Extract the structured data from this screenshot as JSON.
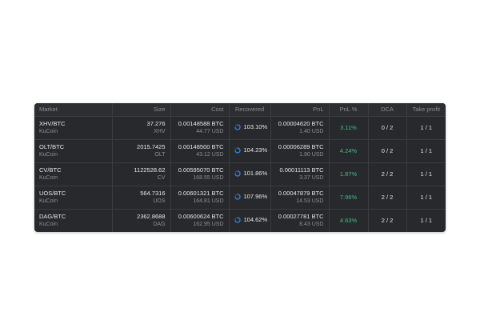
{
  "columns": {
    "market": "Market",
    "size": "Size",
    "cost": "Cost",
    "recovered": "Recovered",
    "pnl": "PnL",
    "pnl_pct": "PnL %",
    "dca": "DCA",
    "take_profit": "Take profit"
  },
  "colors": {
    "panel_bg": "#27292c",
    "accent_blue": "#2f80ed",
    "positive_green": "#3ec17b"
  },
  "rows": [
    {
      "pair": "XHV/BTC",
      "exchange": "KuCoin",
      "size": "37.276",
      "size_unit": "XHV",
      "cost_btc": "0.00148588 BTC",
      "cost_usd": "44.77 USD",
      "recovered": "103.10%",
      "pnl_btc": "0.00004620 BTC",
      "pnl_usd": "1.40 USD",
      "pnl_pct": "3.11%",
      "dca": "0 / 2",
      "take_profit": "1 / 1"
    },
    {
      "pair": "OLT/BTC",
      "exchange": "KuCoin",
      "size": "2015.7425",
      "size_unit": "OLT",
      "cost_btc": "0.00148500 BTC",
      "cost_usd": "43.12 USD",
      "recovered": "104.23%",
      "pnl_btc": "0.00006289 BTC",
      "pnl_usd": "1.90 USD",
      "pnl_pct": "4.24%",
      "dca": "0 / 2",
      "take_profit": "1 / 1"
    },
    {
      "pair": "CV/BTC",
      "exchange": "KuCoin",
      "size": "1122528.62",
      "size_unit": "CV",
      "cost_btc": "0.00595070 BTC",
      "cost_usd": "168.55 USD",
      "recovered": "101.86%",
      "pnl_btc": "0.00011113 BTC",
      "pnl_usd": "3.37 USD",
      "pnl_pct": "1.87%",
      "dca": "2 / 2",
      "take_profit": "1 / 1"
    },
    {
      "pair": "UOS/BTC",
      "exchange": "KuCoin",
      "size": "564.7316",
      "size_unit": "UOS",
      "cost_btc": "0.00601321 BTC",
      "cost_usd": "164.81 USD",
      "recovered": "107.96%",
      "pnl_btc": "0.00047879 BTC",
      "pnl_usd": "14.53 USD",
      "pnl_pct": "7.96%",
      "dca": "2 / 2",
      "take_profit": "1 / 1"
    },
    {
      "pair": "DAG/BTC",
      "exchange": "KuCoin",
      "size": "2362.8688",
      "size_unit": "DAG",
      "cost_btc": "0.00600624 BTC",
      "cost_usd": "162.95 USD",
      "recovered": "104.62%",
      "pnl_btc": "0.00027781 BTC",
      "pnl_usd": "8.43 USD",
      "pnl_pct": "4.63%",
      "dca": "2 / 2",
      "take_profit": "1 / 1"
    }
  ]
}
